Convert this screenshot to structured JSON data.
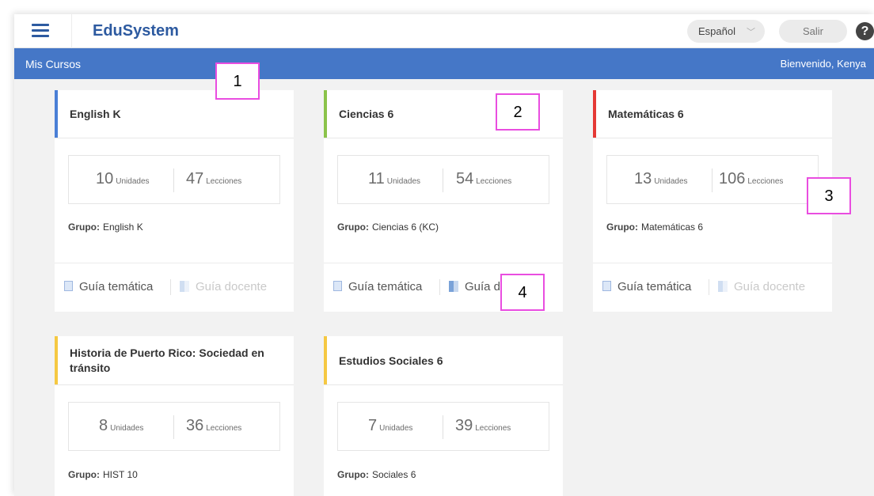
{
  "header": {
    "brand": "EduSystem",
    "language": "Español",
    "logout": "Salir",
    "help": "?"
  },
  "bar": {
    "title": "Mis Cursos",
    "welcome": "Bienvenido, Kenya"
  },
  "labels": {
    "units": "Unidades",
    "lessons": "Lecciones",
    "group": "Grupo:",
    "guide_a": "Guía temática",
    "guide_b": "Guía docente"
  },
  "courses": [
    {
      "name": "English K",
      "units": "10",
      "lessons": "47",
      "group": "English K",
      "accent": "#4a7fd6"
    },
    {
      "name": "Ciencias 6",
      "units": "11",
      "lessons": "54",
      "group": "Ciencias 6 (KC)",
      "accent": "#8bc34a"
    },
    {
      "name": "Matemáticas 6",
      "units": "13",
      "lessons": "106",
      "group": "Matemáticas 6",
      "accent": "#e53935"
    },
    {
      "name": "Historia de Puerto Rico: Sociedad en tránsito",
      "units": "8",
      "lessons": "36",
      "group": "HIST 10",
      "accent": "#f5c842"
    },
    {
      "name": "Estudios Sociales 6",
      "units": "7",
      "lessons": "39",
      "group": "Sociales 6",
      "accent": "#f5c842"
    }
  ],
  "markers": [
    "1",
    "2",
    "3",
    "4"
  ]
}
